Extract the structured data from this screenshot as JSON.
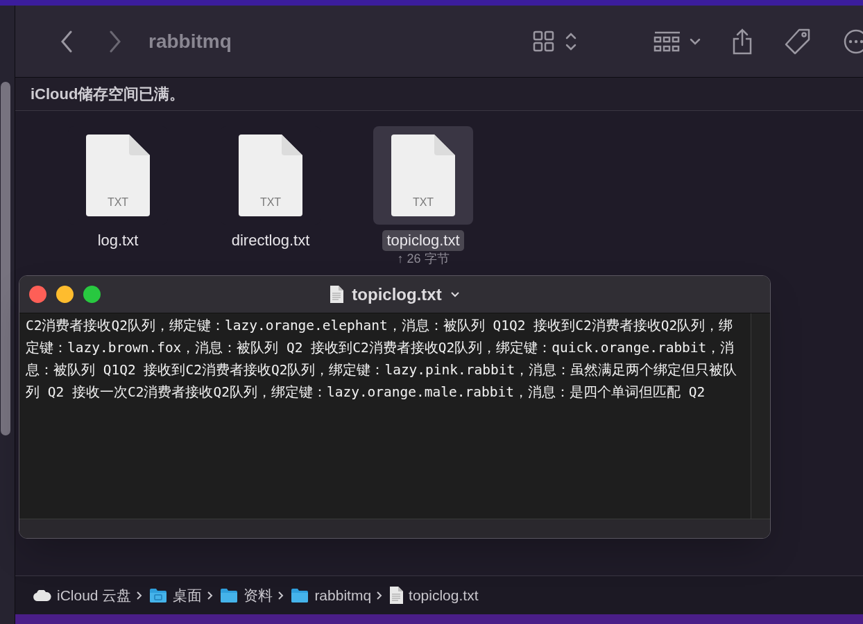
{
  "toolbar": {
    "title": "rabbitmq"
  },
  "notice": "iCloud储存空间已满。",
  "files": [
    {
      "name": "log.txt",
      "badge": "TXT",
      "selected": false
    },
    {
      "name": "directlog.txt",
      "badge": "TXT",
      "selected": false
    },
    {
      "name": "topiclog.txt",
      "badge": "TXT",
      "selected": true,
      "info": "↑ 26 字节"
    }
  ],
  "preview": {
    "title": "topiclog.txt",
    "content": "C2消费者接收Q2队列，绑定键：lazy.orange.elephant，消息：被队列 Q1Q2 接收到C2消费者接收Q2队列，绑定键：lazy.brown.fox，消息：被队列 Q2 接收到C2消费者接收Q2队列，绑定键：quick.orange.rabbit，消息：被队列 Q1Q2 接收到C2消费者接收Q2队列，绑定键：lazy.pink.rabbit，消息：虽然满足两个绑定但只被队列 Q2 接收一次C2消费者接收Q2队列，绑定键：lazy.orange.male.rabbit，消息：是四个单词但匹配 Q2"
  },
  "path_bar": [
    {
      "kind": "cloud",
      "label": "iCloud 云盘"
    },
    {
      "kind": "desktop",
      "label": "桌面"
    },
    {
      "kind": "folder",
      "label": "资料"
    },
    {
      "kind": "folder",
      "label": "rabbitmq"
    },
    {
      "kind": "file",
      "label": "topiclog.txt"
    }
  ]
}
